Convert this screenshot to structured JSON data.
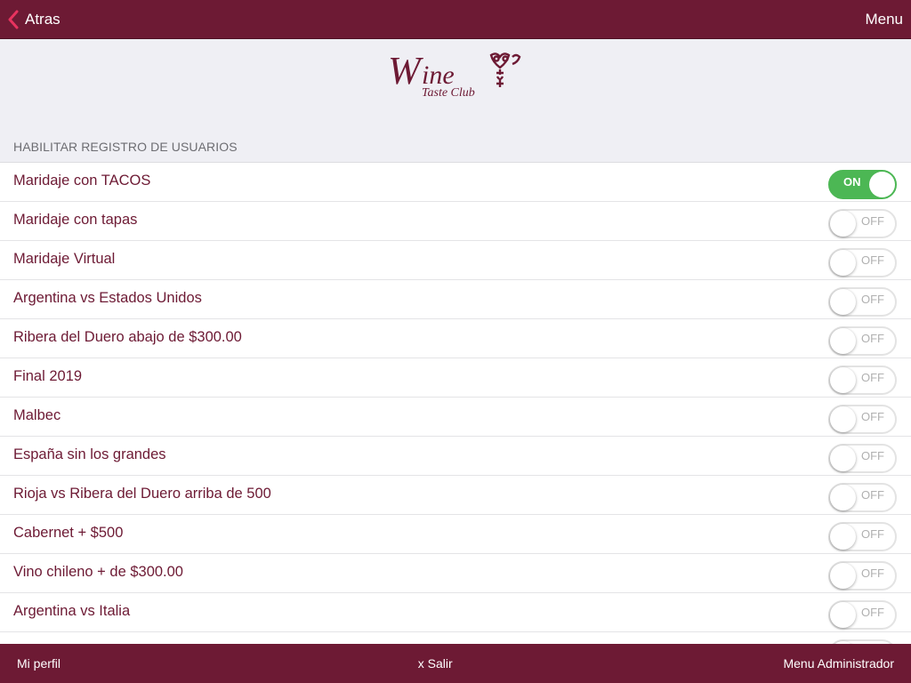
{
  "header": {
    "back_label": "Atras",
    "menu_label": "Menu"
  },
  "brand": {
    "logo_word": "Wine",
    "logo_sub": "Taste Club",
    "color": "#6d1a34"
  },
  "section": {
    "title": "HABILITAR REGISTRO DE USUARIOS"
  },
  "items": [
    {
      "label": "Maridaje con TACOS",
      "state": "ON",
      "on": true
    },
    {
      "label": "Maridaje con tapas",
      "state": "OFF",
      "on": false
    },
    {
      "label": "Maridaje Virtual",
      "state": "OFF",
      "on": false
    },
    {
      "label": "Argentina vs Estados Unidos",
      "state": "OFF",
      "on": false
    },
    {
      "label": "Ribera del Duero abajo de $300.00",
      "state": "OFF",
      "on": false
    },
    {
      "label": "Final 2019",
      "state": "OFF",
      "on": false
    },
    {
      "label": "Malbec",
      "state": "OFF",
      "on": false
    },
    {
      "label": "España sin los grandes",
      "state": "OFF",
      "on": false
    },
    {
      "label": "Rioja vs Ribera del Duero arriba de 500",
      "state": "OFF",
      "on": false
    },
    {
      "label": "Cabernet + $500",
      "state": "OFF",
      "on": false
    },
    {
      "label": "Vino chileno + de $300.00",
      "state": "OFF",
      "on": false
    },
    {
      "label": "Argentina vs Italia",
      "state": "OFF",
      "on": false
    },
    {
      "label": "",
      "state": "",
      "on": false
    }
  ],
  "footer": {
    "profile_label": "Mi perfil",
    "logout_label": "x Salir",
    "admin_label": "Menu Administrador"
  },
  "colors": {
    "bar": "#6d1a34",
    "accent_back": "#e8335f",
    "toggle_on": "#4cb754"
  }
}
